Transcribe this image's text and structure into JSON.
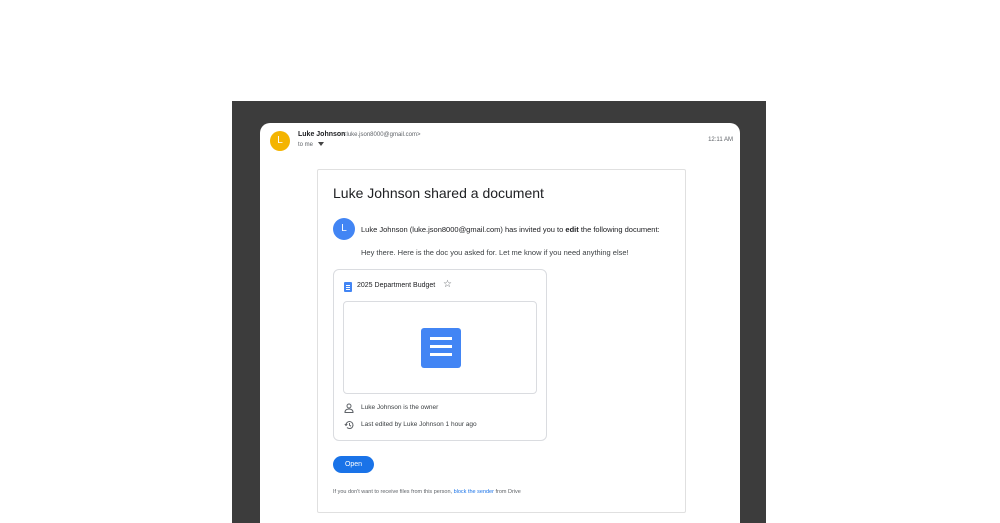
{
  "email": {
    "sender_initial": "L",
    "sender_name": "Luke Johnson",
    "sender_email": "<luke.json8000@gmail.com>",
    "to_label": "to me",
    "time": "12:11 AM"
  },
  "share": {
    "title": "Luke Johnson shared a document",
    "inviter_initial": "L",
    "invite_prefix": "Luke Johnson (luke.json8000@gmail.com) has invited you to ",
    "invite_permission": "edit",
    "invite_suffix": " the following document:",
    "message": "Hey there. Here is the doc you asked for. Let me know if you need anything else!",
    "document": {
      "name": "2025 Department Budget",
      "owner_text": "Luke Johnson is the owner",
      "edited_text": "Last edited by Luke Johnson 1 hour ago"
    },
    "open_label": "Open",
    "footer_prefix": "If you don't want to receive files from this person, ",
    "footer_link": "block the sender",
    "footer_suffix": " from Drive"
  },
  "colors": {
    "sender_avatar": "#f4b400",
    "inviter_avatar": "#4285f4",
    "docs_blue": "#4285f4",
    "button_blue": "#1a73e8",
    "backdrop": "#3c3c3c"
  },
  "icons": [
    "chevron-down-icon",
    "google-docs-icon",
    "star-icon",
    "person-icon",
    "history-icon"
  ]
}
